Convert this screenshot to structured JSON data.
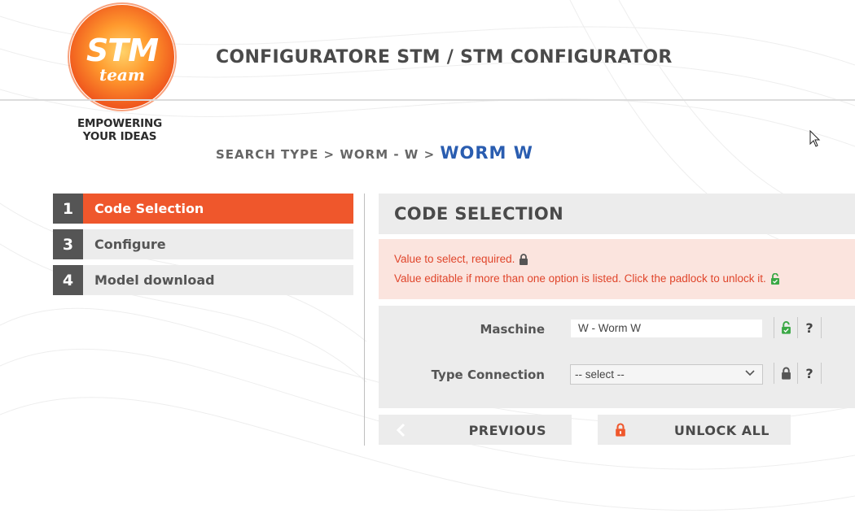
{
  "header": {
    "logo": {
      "text_main": "STM",
      "text_sub": "team",
      "tagline_1": "EMPOWERING",
      "tagline_2": "YOUR IDEAS"
    },
    "title": "CONFIGURATORE STM / STM CONFIGURATOR"
  },
  "breadcrumb": {
    "item_1": "SEARCH TYPE",
    "sep": " > ",
    "item_2": "WORM - W",
    "current": "WORM W"
  },
  "steps": [
    {
      "number": "1",
      "label": "Code Selection",
      "active": true
    },
    {
      "number": "3",
      "label": "Configure",
      "active": false
    },
    {
      "number": "4",
      "label": "Model download",
      "active": false
    }
  ],
  "panel": {
    "title": "CODE SELECTION",
    "notice": {
      "line_1": "Value to select, required.",
      "line_2": "Value editable if more than one option is listed. Click the padlock to unlock it."
    },
    "fields": [
      {
        "label": "Maschine",
        "value": "W - Worm W",
        "lock": "unlocked",
        "help": "?"
      },
      {
        "label": "Type Connection",
        "selected": "-- select --",
        "lock": "locked",
        "help": "?"
      }
    ]
  },
  "buttons": {
    "previous": "PREVIOUS",
    "unlock_all": "UNLOCK ALL"
  },
  "colors": {
    "accent": "#ef572c",
    "breadcrumb_current": "#2a5db0",
    "unlocked": "#3aa845",
    "notice_bg": "#fbe4de",
    "notice_text": "#e0452b"
  }
}
